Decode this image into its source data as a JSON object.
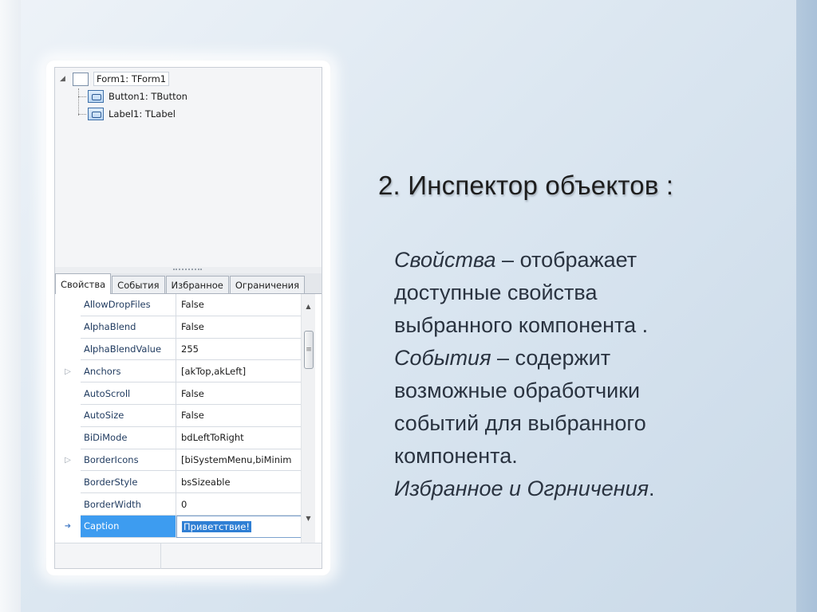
{
  "slide": {
    "title": "2. Инспектор объектов  :",
    "body": {
      "p1_term": "Свойства",
      "p1_dash": " – ",
      "p1_l1": "отображает",
      "p1_l2": "доступные свойства",
      "p1_l3": "выбранного компонента .",
      "p2_term": "События",
      "p2_dash": " – ",
      "p2_l1": "содержит",
      "p2_l2": "возможные обработчики",
      "p2_l3": "событий для выбранного",
      "p2_l4": "компонента.",
      "p3_term": "Избранное и Огрничения",
      "p3_end": "."
    }
  },
  "inspector": {
    "tree": {
      "root": {
        "label": "Form1: TForm1",
        "icon": "form-icon"
      },
      "children": [
        {
          "label": "Button1: TButton",
          "icon": "button-component-icon"
        },
        {
          "label": "Label1: TLabel",
          "icon": "button-component-icon"
        }
      ]
    },
    "tabs": [
      "Свойства",
      "События",
      "Избранное",
      "Ограничения"
    ],
    "active_tab": "Свойства",
    "properties": [
      {
        "name": "AllowDropFiles",
        "value": "False",
        "marker": ""
      },
      {
        "name": "AlphaBlend",
        "value": "False",
        "marker": ""
      },
      {
        "name": "AlphaBlendValue",
        "value": "255",
        "marker": ""
      },
      {
        "name": "Anchors",
        "value": "[akTop,akLeft]",
        "marker": "▷"
      },
      {
        "name": "AutoScroll",
        "value": "False",
        "marker": ""
      },
      {
        "name": "AutoSize",
        "value": "False",
        "marker": ""
      },
      {
        "name": "BiDiMode",
        "value": "bdLeftToRight",
        "marker": ""
      },
      {
        "name": "BorderIcons",
        "value": "[biSystemMenu,biMinim",
        "marker": "▷"
      },
      {
        "name": "BorderStyle",
        "value": "bsSizeable",
        "marker": ""
      },
      {
        "name": "BorderWidth",
        "value": "0",
        "marker": ""
      },
      {
        "name": "Caption",
        "value": "Приветствие!",
        "marker": "➜"
      }
    ],
    "selected_property": "Caption",
    "scroll_icons": {
      "up": "scroll-up-arrow-icon",
      "down": "scroll-down-arrow-icon",
      "thumb": "scroll-grip-icon"
    }
  },
  "colors": {
    "selection": "#3d9cf0",
    "text_selection": "#2f7fd4",
    "background": "#dce7f1"
  }
}
